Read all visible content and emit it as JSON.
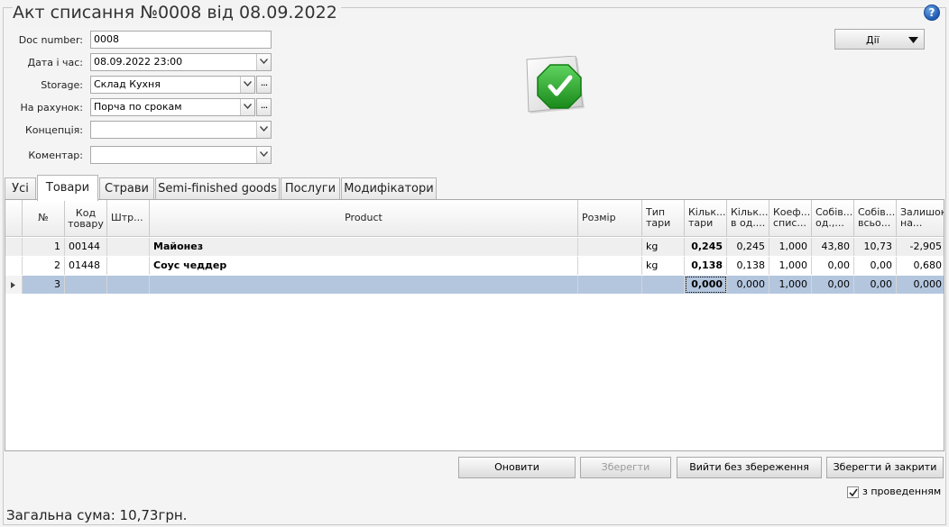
{
  "window": {
    "title": "Акт списання №0008 від 08.09.2022",
    "help": "?"
  },
  "form": {
    "doc_number": {
      "label": "Doc number:",
      "value": "0008"
    },
    "datetime": {
      "label": "Дата і час:",
      "value": "08.09.2022 23:00"
    },
    "storage": {
      "label": "Storage:",
      "value": "Склад Кухня",
      "more": "..."
    },
    "account": {
      "label": "На рахунок:",
      "value": "Порча по срокам",
      "more": "..."
    },
    "concept": {
      "label": "Концепція:",
      "value": ""
    },
    "comment": {
      "label": "Коментар:",
      "value": ""
    }
  },
  "actions_button": {
    "label": "Дії"
  },
  "status_icon": "document-approved-icon",
  "tabs": [
    {
      "label": "Усі"
    },
    {
      "label": "Товари",
      "active": true
    },
    {
      "label": "Страви"
    },
    {
      "label": "Semi-finished goods"
    },
    {
      "label": "Послуги"
    },
    {
      "label": "Модифікатори"
    }
  ],
  "columns": [
    "№",
    "Код товару",
    "Штр...",
    "Product",
    "Розмір",
    "Тип тари",
    "Кільк... тари",
    "Кільк... в од....",
    "Коеф... спис...",
    "Собів... од.,...",
    "Собів... всьо...",
    "Залишок на..."
  ],
  "rows": [
    {
      "n": "1",
      "code": "00144",
      "barcode": "",
      "product": "Майонез",
      "size": "",
      "unit": "kg",
      "qty": "0,245",
      "qty_unit": "0,245",
      "coef": "1,000",
      "cost_unit": "43,80",
      "cost_total": "10,73",
      "rest": "-2,905"
    },
    {
      "n": "2",
      "code": "01448",
      "barcode": "",
      "product": "Соус чеддер",
      "size": "",
      "unit": "kg",
      "qty": "0,138",
      "qty_unit": "0,138",
      "coef": "1,000",
      "cost_unit": "0,00",
      "cost_total": "0,00",
      "rest": "0,680"
    },
    {
      "n": "3",
      "code": "",
      "barcode": "",
      "product": "",
      "size": "",
      "unit": "",
      "qty": "0,000",
      "qty_unit": "0,000",
      "coef": "1,000",
      "cost_unit": "0,00",
      "cost_total": "0,00",
      "rest": "0,000"
    }
  ],
  "buttons": {
    "refresh": "Оновити",
    "save": "Зберегти",
    "exit_no_save": "Вийти без збереження",
    "save_close": "Зберегти й закрити"
  },
  "with_posting": {
    "label": "з проведенням",
    "checked": true
  },
  "total": "Загальна сума: 10,73грн.",
  "colors": {
    "selected_row": "#b4c6de",
    "accent": "#1e5bb4",
    "icon_green": "#2fa42f"
  }
}
